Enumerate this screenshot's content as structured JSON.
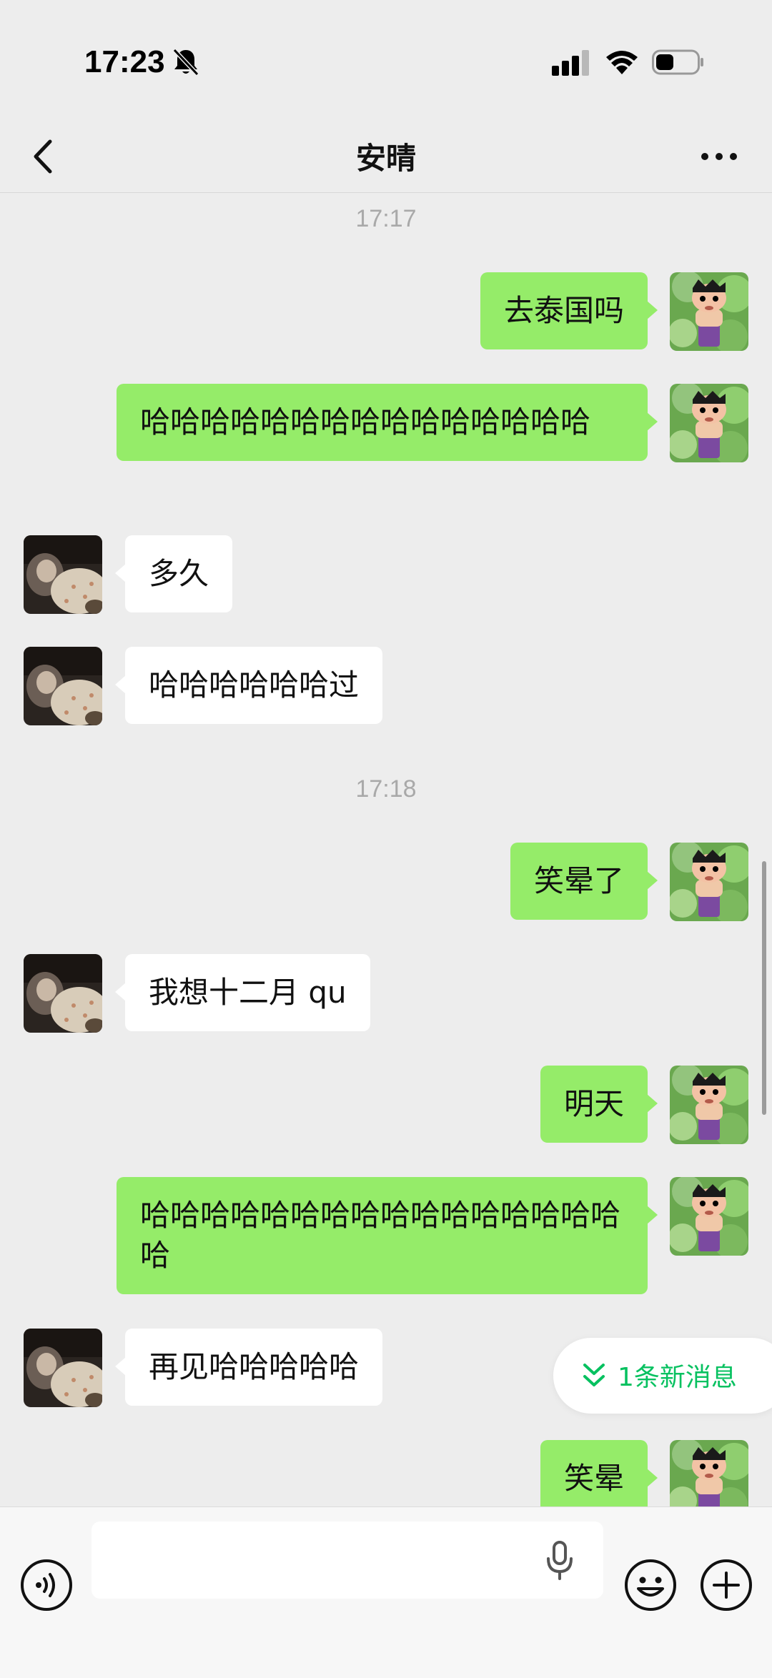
{
  "status_bar": {
    "time": "17:23"
  },
  "header": {
    "title": "安晴"
  },
  "messages": [
    {
      "type": "time",
      "text": "17:17"
    },
    {
      "type": "sent",
      "text": "去泰国吗"
    },
    {
      "type": "sent",
      "text": "哈哈哈哈哈哈哈哈哈哈哈哈哈哈哈"
    },
    {
      "type": "received",
      "text": "多久"
    },
    {
      "type": "received",
      "text": "哈哈哈哈哈哈过"
    },
    {
      "type": "time",
      "text": "17:18"
    },
    {
      "type": "sent",
      "text": "笑晕了"
    },
    {
      "type": "received",
      "text": "我想十二月 qu"
    },
    {
      "type": "sent",
      "text": "明天"
    },
    {
      "type": "sent",
      "text": "哈哈哈哈哈哈哈哈哈哈哈哈哈哈哈哈哈"
    },
    {
      "type": "received",
      "text": "再见哈哈哈哈哈"
    },
    {
      "type": "sent",
      "text": "笑晕"
    }
  ],
  "new_message_pill": {
    "label": "1条新消息"
  },
  "composer": {
    "value": "",
    "placeholder": ""
  },
  "colors": {
    "sent_bubble": "#95ec69",
    "received_bubble": "#ffffff",
    "accent": "#07c160",
    "background": "#ededed"
  },
  "icons": {
    "mute": "bell-slash-icon",
    "signal": "signal-icon",
    "wifi": "wifi-icon",
    "battery": "battery-icon",
    "back": "chevron-left-icon",
    "more": "more-dots-icon",
    "new_messages": "double-chevron-down-icon",
    "voice": "voice-icon",
    "mic": "microphone-icon",
    "emoji": "emoji-icon",
    "add": "plus-icon"
  }
}
